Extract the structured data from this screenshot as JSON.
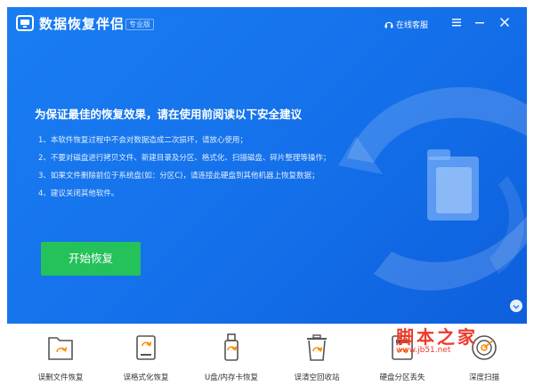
{
  "app": {
    "title": "数据恢复伴侣",
    "edition": "专业版",
    "support_label": "在线客服"
  },
  "main": {
    "headline": "为保证最佳的恢复效果，请在使用前阅读以下安全建议",
    "tips": [
      "1、本软件恢复过程中不会对数据造成二次损坏，请放心使用；",
      "2、不要对磁盘进行拷贝文件、新建目录及分区、格式化、扫描磁盘、碎片整理等操作；",
      "3、如果文件删除前位于系统盘(如：分区C)，请连接此硬盘到其他机器上恢复数据；",
      "4、建议关闭其他软件。"
    ],
    "start_label": "开始恢复"
  },
  "modes": [
    {
      "label": "误删文件恢复",
      "icon": "folder-restore-icon"
    },
    {
      "label": "误格式化恢复",
      "icon": "drive-restore-icon"
    },
    {
      "label": "U盘/内存卡恢复",
      "icon": "usb-drive-icon"
    },
    {
      "label": "误清空回收站",
      "icon": "recycle-bin-icon"
    },
    {
      "label": "硬盘分区丢失",
      "icon": "partition-icon"
    },
    {
      "label": "深度扫描",
      "icon": "radar-scan-icon"
    }
  ],
  "watermark": {
    "cn": "脚本之家",
    "url": "www.jb51.net"
  },
  "colors": {
    "primary": "#1a7df2",
    "start_button": "#25c15a",
    "icon_accent": "#ff8a00",
    "watermark": "#ee3a2a"
  }
}
